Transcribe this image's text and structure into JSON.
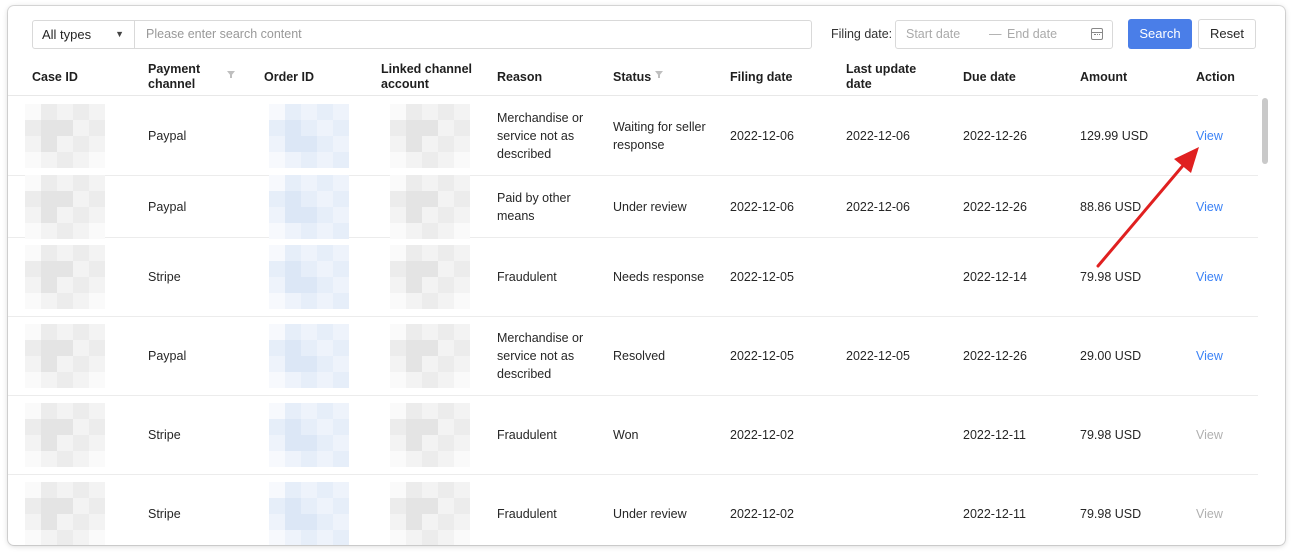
{
  "toolbar": {
    "type_select": "All types",
    "search_placeholder": "Please enter search content",
    "filing_date_label": "Filing date:",
    "start_date_placeholder": "Start date",
    "range_separator": "—",
    "end_date_placeholder": "End date",
    "search_button": "Search",
    "reset_button": "Reset"
  },
  "columns": {
    "case_id": "Case ID",
    "payment_channel": "Payment channel",
    "order_id": "Order ID",
    "linked_account": "Linked channel account",
    "reason": "Reason",
    "status": "Status",
    "filing_date": "Filing date",
    "last_update": "Last update date",
    "due_date": "Due date",
    "amount": "Amount",
    "action": "Action"
  },
  "rows": [
    {
      "channel": "Paypal",
      "reason": "Merchandise or service not as described",
      "status": "Waiting for seller response",
      "filing": "2022-12-06",
      "updated": "2022-12-06",
      "due": "2022-12-26",
      "amount": "129.99 USD",
      "action": "View"
    },
    {
      "channel": "Paypal",
      "reason": "Paid by other means",
      "status": "Under review",
      "filing": "2022-12-06",
      "updated": "2022-12-06",
      "due": "2022-12-26",
      "amount": "88.86 USD",
      "action": "View"
    },
    {
      "channel": "Stripe",
      "reason": "Fraudulent",
      "status": "Needs response",
      "filing": "2022-12-05",
      "updated": "",
      "due": "2022-12-14",
      "amount": "79.98 USD",
      "action": "View"
    },
    {
      "channel": "Paypal",
      "reason": "Merchandise or service not as described",
      "status": "Resolved",
      "filing": "2022-12-05",
      "updated": "2022-12-05",
      "due": "2022-12-26",
      "amount": "29.00 USD",
      "action": "View"
    },
    {
      "channel": "Stripe",
      "reason": "Fraudulent",
      "status": "Won",
      "filing": "2022-12-02",
      "updated": "",
      "due": "2022-12-11",
      "amount": "79.98 USD",
      "action": "View"
    },
    {
      "channel": "Stripe",
      "reason": "Fraudulent",
      "status": "Under review",
      "filing": "2022-12-02",
      "updated": "",
      "due": "2022-12-11",
      "amount": "79.98 USD",
      "action": "View"
    }
  ],
  "colors": {
    "primary": "#4a7ee8",
    "link": "#3b82f6",
    "link_disabled": "#b0b0b0",
    "annotation_arrow": "#e02020"
  }
}
